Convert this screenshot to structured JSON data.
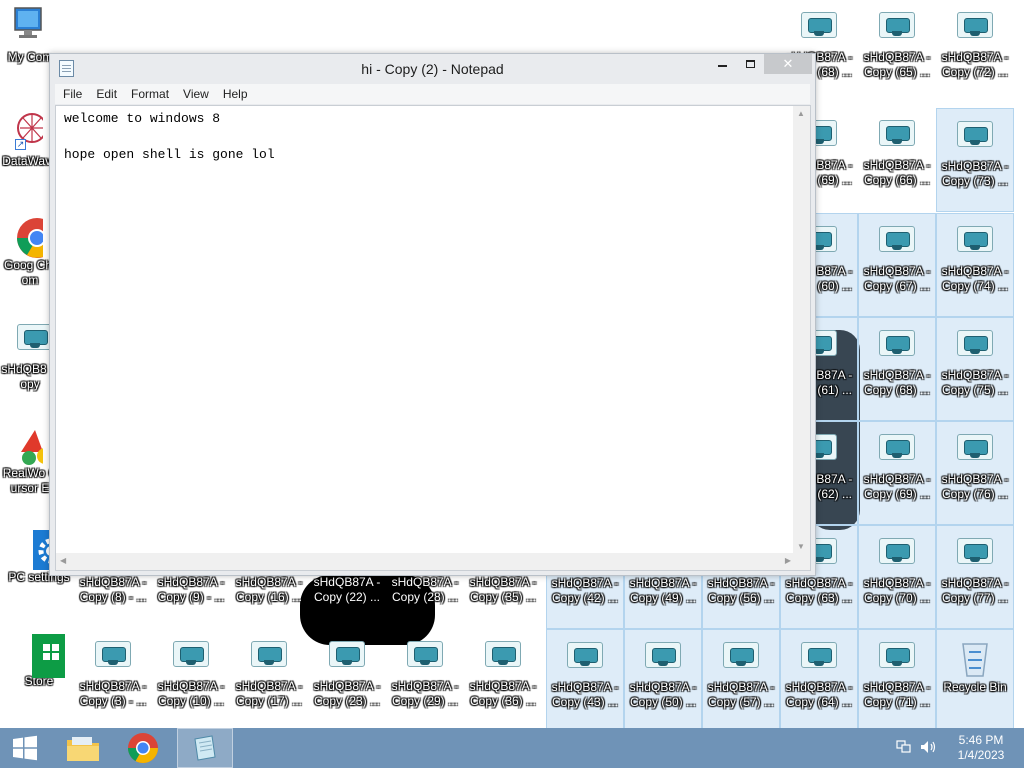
{
  "notepad": {
    "title": "hi - Copy (2) - Notepad",
    "menu": [
      "File",
      "Edit",
      "Format",
      "View",
      "Help"
    ],
    "content": "welcome to windows 8\n\nhope open shell is gone lol",
    "close_glyph": "✕"
  },
  "desktop": {
    "system_icons": [
      {
        "id": "my-computer",
        "label": "My Com",
        "icon": "computer-icon"
      },
      {
        "id": "datawave",
        "label": "DataWave",
        "icon": "datawave-icon"
      },
      {
        "id": "google-chrome",
        "label": "Goog Chrom",
        "icon": "chrome-icon"
      },
      {
        "id": "shd-copy-left",
        "label": "sHdQB8 Copy",
        "icon": "shortcut-thumb-icon"
      },
      {
        "id": "realworld",
        "label": "RealWo Cursor E",
        "icon": "realworld-icon"
      },
      {
        "id": "pc-settings",
        "label": "PC settings",
        "icon": "gear-icon"
      },
      {
        "id": "store",
        "label": "Store",
        "icon": "store-icon"
      }
    ],
    "copy_icons_top_row": [
      "",
      "",
      "",
      "",
      "",
      "",
      "",
      "",
      "",
      "",
      "",
      "",
      ""
    ],
    "copy_icons": [
      {
        "label": "sHdQB87A - Copy (68) ...",
        "col": 10,
        "row": 0
      },
      {
        "label": "sHdQB87A - Copy (65) ...",
        "col": 11,
        "row": 0
      },
      {
        "label": "sHdQB87A - Copy (72) ...",
        "col": 12,
        "row": 0
      },
      {
        "label": "sHdQB87A - Copy (69) ...",
        "col": 10,
        "row": 1
      },
      {
        "label": "sHdQB87A - Copy (66) ...",
        "col": 11,
        "row": 1
      },
      {
        "label": "sHdQB87A - Copy (73) ...",
        "col": 12,
        "row": 1
      },
      {
        "label": "sHdQB87A - Copy (60) ...",
        "col": 10,
        "row": 2
      },
      {
        "label": "sHdQB87A - Copy (67) ...",
        "col": 11,
        "row": 2
      },
      {
        "label": "sHdQB87A - Copy (74) ...",
        "col": 12,
        "row": 2
      },
      {
        "label": "sHdQB87A - Copy (61) ...",
        "col": 10,
        "row": 3
      },
      {
        "label": "sHdQB87A - Copy (68) ...",
        "col": 11,
        "row": 3
      },
      {
        "label": "sHdQB87A - Copy (75) ...",
        "col": 12,
        "row": 3
      },
      {
        "label": "sHdQB87A - Copy (62) ...",
        "col": 10,
        "row": 4
      },
      {
        "label": "sHdQB87A - Copy (69) ...",
        "col": 11,
        "row": 4
      },
      {
        "label": "sHdQB87A - Copy (76) ...",
        "col": 12,
        "row": 4
      },
      {
        "label": "sHdQB87A - Copy (8) - ...",
        "col": 1,
        "row": 5
      },
      {
        "label": "sHdQB87A - Copy (9) - ...",
        "col": 2,
        "row": 5
      },
      {
        "label": "sHdQB87A - Copy (16) ...",
        "col": 3,
        "row": 5
      },
      {
        "label": "sHdQB87A - Copy (22) ...",
        "col": 4,
        "row": 5
      },
      {
        "label": "sHdQB87A - Copy (28) ...",
        "col": 5,
        "row": 5
      },
      {
        "label": "sHdQB87A - Copy (35) ...",
        "col": 6,
        "row": 5
      },
      {
        "label": "sHdQB87A - Copy (42) ...",
        "col": 7,
        "row": 5
      },
      {
        "label": "sHdQB87A - Copy (49) ...",
        "col": 8,
        "row": 5
      },
      {
        "label": "sHdQB87A - Copy (56) ...",
        "col": 9,
        "row": 5
      },
      {
        "label": "sHdQB87A - Copy (63) ...",
        "col": 10,
        "row": 5
      },
      {
        "label": "sHdQB87A - Copy (70) ...",
        "col": 11,
        "row": 5
      },
      {
        "label": "sHdQB87A - Copy (77) ...",
        "col": 12,
        "row": 5
      },
      {
        "label": "sHdQB87A - Copy (3) - ...",
        "col": 1,
        "row": 6
      },
      {
        "label": "sHdQB87A - Copy (10) ...",
        "col": 2,
        "row": 6
      },
      {
        "label": "sHdQB87A - Copy (17) ...",
        "col": 3,
        "row": 6
      },
      {
        "label": "sHdQB87A - Copy (23) ...",
        "col": 4,
        "row": 6
      },
      {
        "label": "sHdQB87A - Copy (29) ...",
        "col": 5,
        "row": 6
      },
      {
        "label": "sHdQB87A - Copy (36) ...",
        "col": 6,
        "row": 6
      },
      {
        "label": "sHdQB87A - Copy (43) ...",
        "col": 7,
        "row": 6
      },
      {
        "label": "sHdQB87A - Copy (50) ...",
        "col": 8,
        "row": 6
      },
      {
        "label": "sHdQB87A - Copy (57) ...",
        "col": 9,
        "row": 6
      },
      {
        "label": "sHdQB87A - Copy (64) ...",
        "col": 10,
        "row": 6
      },
      {
        "label": "sHdQB87A - Copy (71) ...",
        "col": 11,
        "row": 6
      }
    ],
    "recycle_bin": {
      "label": "Recycle Bin",
      "icon": "recycle-bin-icon"
    }
  },
  "taskbar": {
    "pinned": [
      {
        "id": "start",
        "icon": "windows-start-icon"
      },
      {
        "id": "explorer",
        "icon": "folder-icon"
      },
      {
        "id": "chrome",
        "icon": "chrome-icon"
      },
      {
        "id": "notepad",
        "icon": "notepad-icon",
        "active": true
      }
    ],
    "clock": {
      "time": "5:46 PM",
      "date": "1/4/2023"
    }
  },
  "colors": {
    "taskbar": "#6f93b7",
    "selection": "#b3d4ee",
    "titlebar": "#e9ebee"
  }
}
